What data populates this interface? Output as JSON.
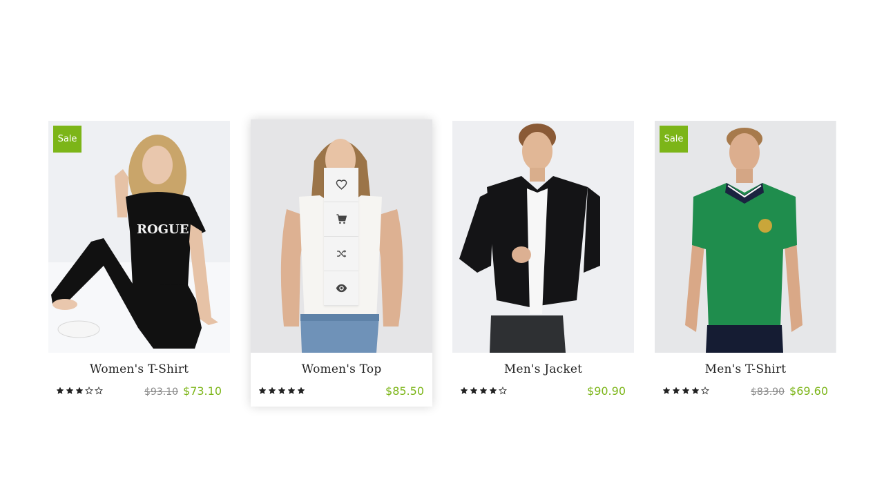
{
  "products": [
    {
      "name": "Women's T-Shirt",
      "sale_badge": "Sale",
      "rating": 3,
      "rating_max": 5,
      "old_price": "$93.10",
      "price": "$73.10"
    },
    {
      "name": "Women's Top",
      "rating": 5,
      "rating_max": 5,
      "price": "$85.50",
      "actions": [
        "heart-icon",
        "cart-icon",
        "shuffle-icon",
        "eye-icon"
      ]
    },
    {
      "name": "Men's Jacket",
      "rating": 4,
      "rating_max": 5,
      "price": "$90.90"
    },
    {
      "name": "Men's T-Shirt",
      "sale_badge": "Sale",
      "rating": 4,
      "rating_max": 5,
      "old_price": "$83.90",
      "price": "$69.60"
    }
  ],
  "colors": {
    "accent": "#7cb518",
    "title": "#222222",
    "old_price": "#8a8a8a",
    "star": "#222222"
  }
}
